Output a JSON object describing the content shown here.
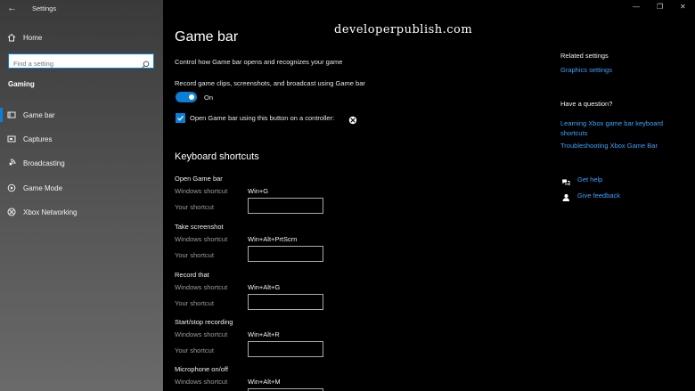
{
  "window": {
    "title": "Settings",
    "back_glyph": "←",
    "minimize_glyph": "—",
    "maximize_glyph": "❐",
    "close_glyph": "✕"
  },
  "sidebar": {
    "home_label": "Home",
    "search_placeholder": "Find a setting",
    "section_label": "Gaming",
    "items": [
      {
        "label": "Game bar",
        "icon": "gamebar-icon",
        "selected": true
      },
      {
        "label": "Captures",
        "icon": "captures-icon",
        "selected": false
      },
      {
        "label": "Broadcasting",
        "icon": "broadcasting-icon",
        "selected": false
      },
      {
        "label": "Game Mode",
        "icon": "gamemode-icon",
        "selected": false
      },
      {
        "label": "Xbox Networking",
        "icon": "xbox-icon",
        "selected": false
      }
    ]
  },
  "main": {
    "title": "Game bar",
    "watermark": "developerpublish.com",
    "description": "Control how Game bar opens and recognizes your game",
    "record_label": "Record game clips, screenshots, and broadcast using Game bar",
    "toggle_state": "On",
    "checkbox_label": "Open Game bar using this button on a controller:",
    "shortcuts_title": "Keyboard shortcuts",
    "windows_shortcut_label": "Windows shortcut",
    "your_shortcut_label": "Your shortcut",
    "shortcuts": [
      {
        "name": "Open Game bar",
        "windows": "Win+G",
        "yours": ""
      },
      {
        "name": "Take screenshot",
        "windows": "Win+Alt+PrtScrn",
        "yours": ""
      },
      {
        "name": "Record that",
        "windows": "Win+Alt+G",
        "yours": ""
      },
      {
        "name": "Start/stop recording",
        "windows": "Win+Alt+R",
        "yours": ""
      },
      {
        "name": "Microphone on/off",
        "windows": "Win+Alt+M",
        "yours": ""
      }
    ]
  },
  "right_panel": {
    "related_heading": "Related settings",
    "graphics_link": "Graphics settings",
    "question_heading": "Have a question?",
    "learn_link_line1": "Learning Xbox game bar keyboard",
    "learn_link_line2": "shortcuts",
    "troubleshoot_link": "Troubleshooting Xbox Game Bar",
    "help_link": "Get help",
    "feedback_link": "Give feedback"
  },
  "colors": {
    "accent": "#0a7fd6",
    "link": "#3aa3ff",
    "background": "#000000"
  }
}
